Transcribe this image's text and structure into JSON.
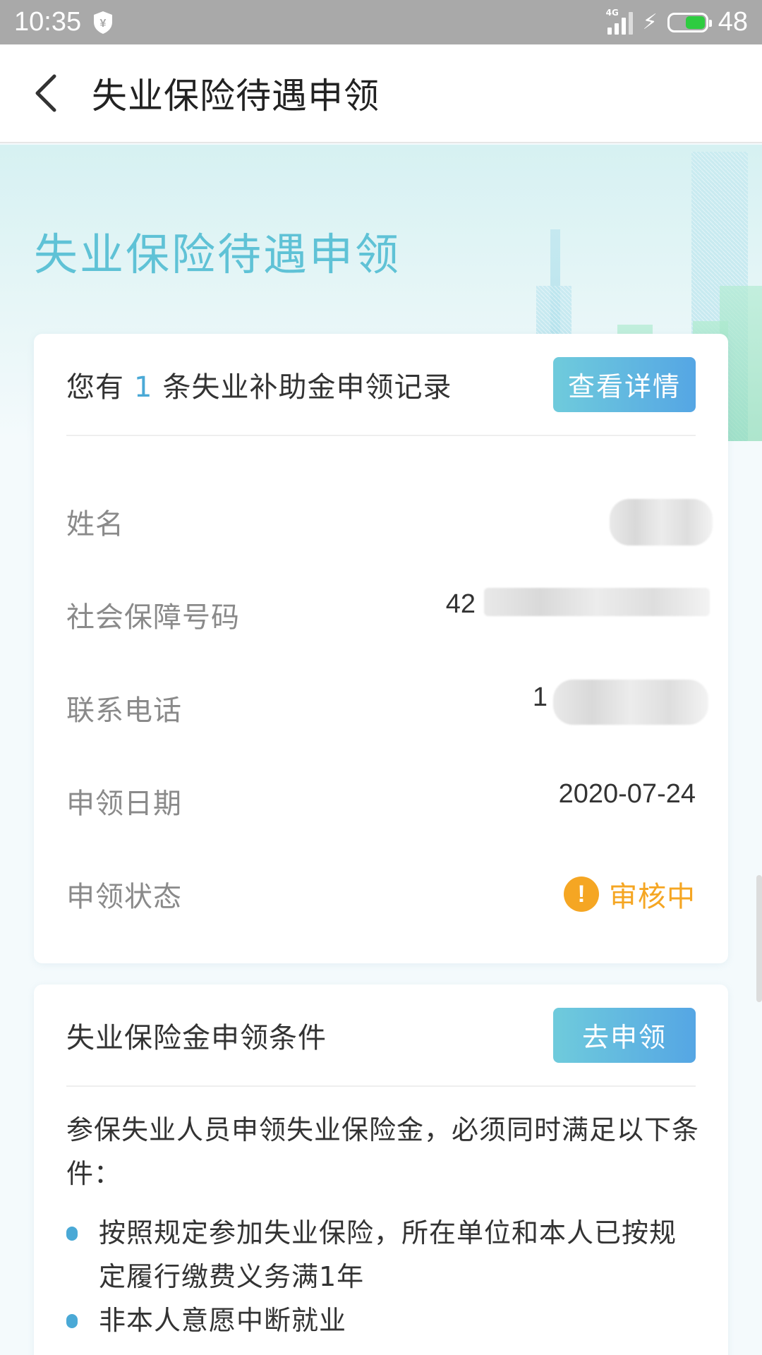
{
  "status_bar": {
    "time": "10:35",
    "network": "4G",
    "battery": "48",
    "icons": [
      "shield-yen-icon",
      "signal-icon",
      "charging-bolt-icon",
      "battery-icon"
    ]
  },
  "header": {
    "title": "失业保险待遇申领",
    "back_icon": "chevron-left-icon"
  },
  "banner": {
    "title": "失业保险待遇申领"
  },
  "record_card": {
    "prefix": "您有",
    "count": "1",
    "suffix": "条失业补助金申领记录",
    "detail_button": "查看详情",
    "rows": [
      {
        "label": "姓名",
        "value": ""
      },
      {
        "label": "社会保障号码",
        "value": "42"
      },
      {
        "label": "联系电话",
        "value": "1"
      },
      {
        "label": "申领日期",
        "value": "2020-07-24"
      },
      {
        "label": "申领状态",
        "value": "审核中"
      }
    ],
    "status_icon": "exclamation-circle-icon",
    "colors": {
      "accent": "#4aa9d6",
      "warning": "#f5a623"
    }
  },
  "conditions_card": {
    "title": "失业保险金申领条件",
    "apply_button": "去申领",
    "intro": "参保失业人员申领失业保险金，必须同时满足以下条件：",
    "items": [
      "按照规定参加失业保险，所在单位和本人已按规定履行缴费义务满1年",
      "非本人意愿中断就业"
    ]
  }
}
